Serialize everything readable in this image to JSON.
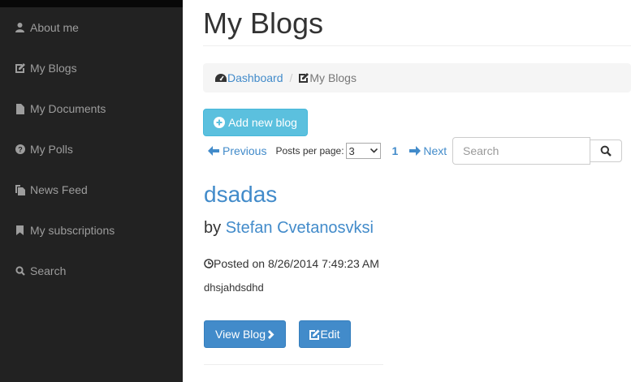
{
  "sidebar": {
    "items": [
      {
        "label": "About me",
        "icon": "user-icon"
      },
      {
        "label": "My Blogs",
        "icon": "edit-icon"
      },
      {
        "label": "My Documents",
        "icon": "file-icon"
      },
      {
        "label": "My Polls",
        "icon": "question-circle-icon"
      },
      {
        "label": "News Feed",
        "icon": "files-icon"
      },
      {
        "label": "My subscriptions",
        "icon": "bookmark-icon"
      },
      {
        "label": "Search",
        "icon": "search-icon"
      }
    ]
  },
  "header": {
    "title": "My Blogs"
  },
  "breadcrumb": {
    "home": "Dashboard",
    "current": "My Blogs"
  },
  "toolbar": {
    "add_label": "Add new blog"
  },
  "pager": {
    "previous": "Previous",
    "per_page_label": "Posts per page:",
    "per_page_value": "3",
    "current_page": "1",
    "next": "Next"
  },
  "search": {
    "placeholder": "Search"
  },
  "post": {
    "title": "dsadas",
    "by": "by",
    "author": "Stefan Cvetanosvksi",
    "posted_on": "Posted on 8/26/2014 7:49:23 AM",
    "body": "dhsjahdsdhd",
    "view_label": "View Blog",
    "edit_label": "Edit"
  },
  "colors": {
    "sidebar_bg": "#222222",
    "link": "#428bca",
    "info_button": "#5bc0de",
    "primary_button": "#428bca"
  }
}
